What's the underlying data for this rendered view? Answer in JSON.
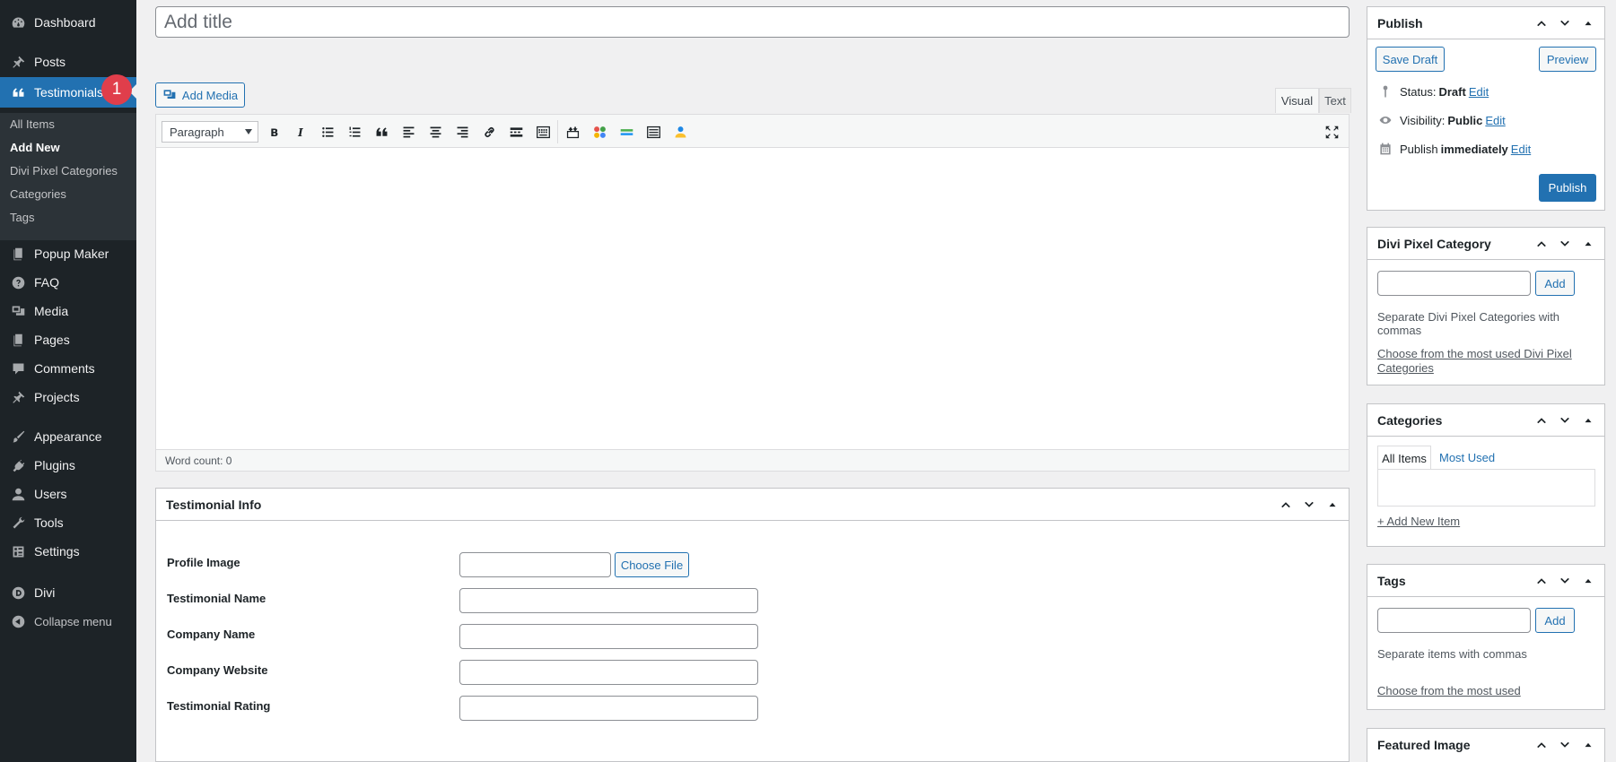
{
  "sidebar": {
    "items": [
      {
        "label": "Dashboard",
        "icon": "dashboard-icon"
      },
      {
        "label": "Posts",
        "icon": "pin-icon"
      },
      {
        "label": "Testimonials",
        "icon": "quote-icon"
      },
      {
        "label": "Popup Maker",
        "icon": "pages-icon"
      },
      {
        "label": "FAQ",
        "icon": "help-icon"
      },
      {
        "label": "Media",
        "icon": "media-icon"
      },
      {
        "label": "Pages",
        "icon": "pages-icon"
      },
      {
        "label": "Comments",
        "icon": "comment-icon"
      },
      {
        "label": "Projects",
        "icon": "pin-icon"
      },
      {
        "label": "Appearance",
        "icon": "brush-icon"
      },
      {
        "label": "Plugins",
        "icon": "plug-icon"
      },
      {
        "label": "Users",
        "icon": "user-icon"
      },
      {
        "label": "Tools",
        "icon": "wrench-icon"
      },
      {
        "label": "Settings",
        "icon": "settings-icon"
      },
      {
        "label": "Divi",
        "icon": "divi-icon"
      }
    ],
    "submenu": [
      "All Items",
      "Add New",
      "Divi Pixel Categories",
      "Categories",
      "Tags"
    ],
    "collapse_label": "Collapse menu",
    "step_badge": "1"
  },
  "title": {
    "placeholder": "Add title"
  },
  "editor": {
    "add_media_label": "Add Media",
    "tab_visual": "Visual",
    "tab_text": "Text",
    "format_value": "Paragraph",
    "word_count": "Word count: 0"
  },
  "testimonial_info": {
    "title": "Testimonial Info",
    "fields": [
      "Profile Image",
      "Testimonial Name",
      "Company Name",
      "Company Website",
      "Testimonial Rating"
    ],
    "choose_file_label": "Choose File"
  },
  "publish": {
    "title": "Publish",
    "save_draft": "Save Draft",
    "preview": "Preview",
    "status_label": "Status:",
    "status_value": "Draft",
    "visibility_label": "Visibility:",
    "visibility_value": "Public",
    "publish_label": "Publish",
    "publish_value": "immediately",
    "edit": "Edit",
    "publish_button": "Publish"
  },
  "divi_category": {
    "title": "Divi Pixel Category",
    "add": "Add",
    "help": "Separate Divi Pixel Categories with commas",
    "link": "Choose from the most used Divi Pixel Categories"
  },
  "categories": {
    "title": "Categories",
    "tab_all": "All Items",
    "tab_most": "Most Used",
    "add_new": "+ Add New Item"
  },
  "tags": {
    "title": "Tags",
    "add": "Add",
    "help": "Separate items with commas",
    "link": "Choose from the most used"
  },
  "featured_image": {
    "title": "Featured Image"
  },
  "colors": {
    "sidebar_bg": "#1d2327",
    "accent": "#2271b1",
    "badge": "#e03e4b"
  }
}
